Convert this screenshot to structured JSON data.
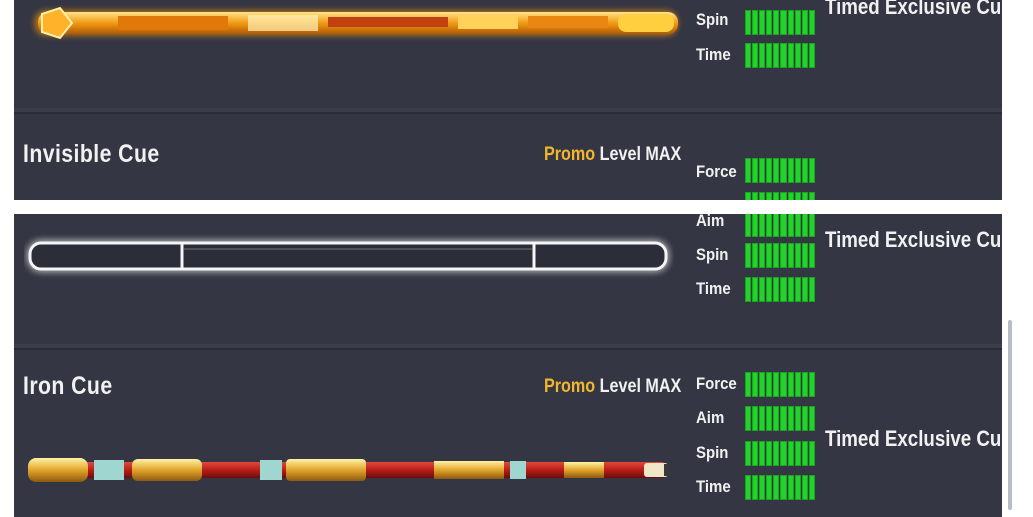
{
  "top_card": {
    "timed_label": "Timed Exclusive Cue",
    "stat_labels": [
      "Spin",
      "Time"
    ]
  },
  "invisible_cue": {
    "name": "Invisible Cue",
    "promo": "Promo",
    "level": "Level MAX",
    "stat_labels": [
      "Force",
      "Aim",
      "Spin",
      "Time"
    ],
    "timed_label": "Timed Exclusive Cue"
  },
  "iron_cue": {
    "name": "Iron Cue",
    "promo": "Promo",
    "level": "Level MAX",
    "stat_labels": [
      "Force",
      "Aim",
      "Spin",
      "Time"
    ],
    "timed_label": "Timed Exclusive Cue"
  },
  "stat_bar_segments": 10,
  "colors": {
    "stat_bar": "#22d42a",
    "promo": "#f2b62e",
    "panel": "#3b3d4b"
  }
}
